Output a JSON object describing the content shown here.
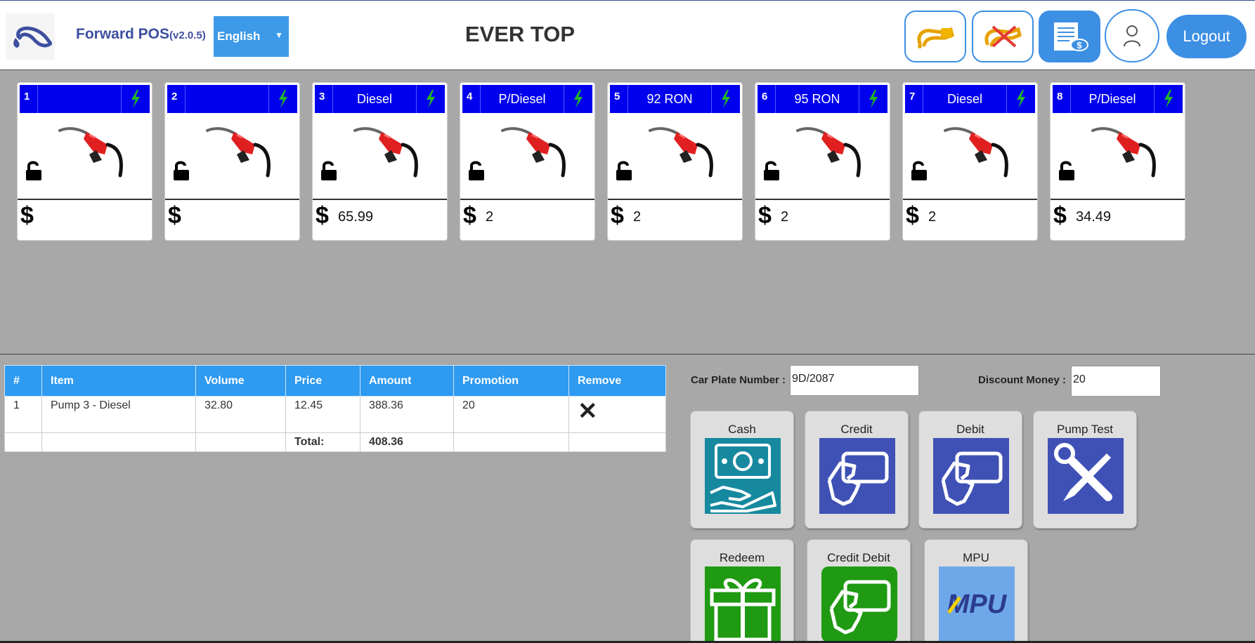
{
  "header": {
    "app_name": "Forward POS",
    "version": "(v2.0.5)",
    "language": "English",
    "station_name": "EVER TOP",
    "logout_label": "Logout"
  },
  "pumps": [
    {
      "number": "1",
      "fuel": "",
      "amount": ""
    },
    {
      "number": "2",
      "fuel": "",
      "amount": ""
    },
    {
      "number": "3",
      "fuel": "Diesel",
      "amount": "65.99"
    },
    {
      "number": "4",
      "fuel": "P/Diesel",
      "amount": "2"
    },
    {
      "number": "5",
      "fuel": "92 RON",
      "amount": "2"
    },
    {
      "number": "6",
      "fuel": "95 RON",
      "amount": "2"
    },
    {
      "number": "7",
      "fuel": "Diesel",
      "amount": "2"
    },
    {
      "number": "8",
      "fuel": "P/Diesel",
      "amount": "34.49"
    }
  ],
  "currency_symbol": "$",
  "cart": {
    "columns": [
      "#",
      "Item",
      "Volume",
      "Price",
      "Amount",
      "Promotion",
      "Remove"
    ],
    "rows": [
      {
        "no": "1",
        "item": "Pump 3 - Diesel",
        "volume": "32.80",
        "price": "12.45",
        "amount": "388.36",
        "promotion": "20"
      }
    ],
    "total_label": "Total:",
    "total_value": "408.36"
  },
  "payment": {
    "car_plate_label": "Car Plate Number :",
    "car_plate_value": "9D/2087",
    "discount_label": "Discount Money :",
    "discount_value": "20",
    "methods": [
      "Cash",
      "Credit",
      "Debit",
      "Pump Test",
      "Redeem",
      "Credit Debit",
      "MPU"
    ],
    "mpu_logo_text": "MPU"
  },
  "colors": {
    "pump_header": "#0000ee",
    "accent": "#3d8fe4",
    "table_header": "#2e9af0",
    "cash": "#16899f",
    "card": "#3f51b5",
    "green": "#1f9a12",
    "mpu_bg": "#6fa8e8"
  }
}
